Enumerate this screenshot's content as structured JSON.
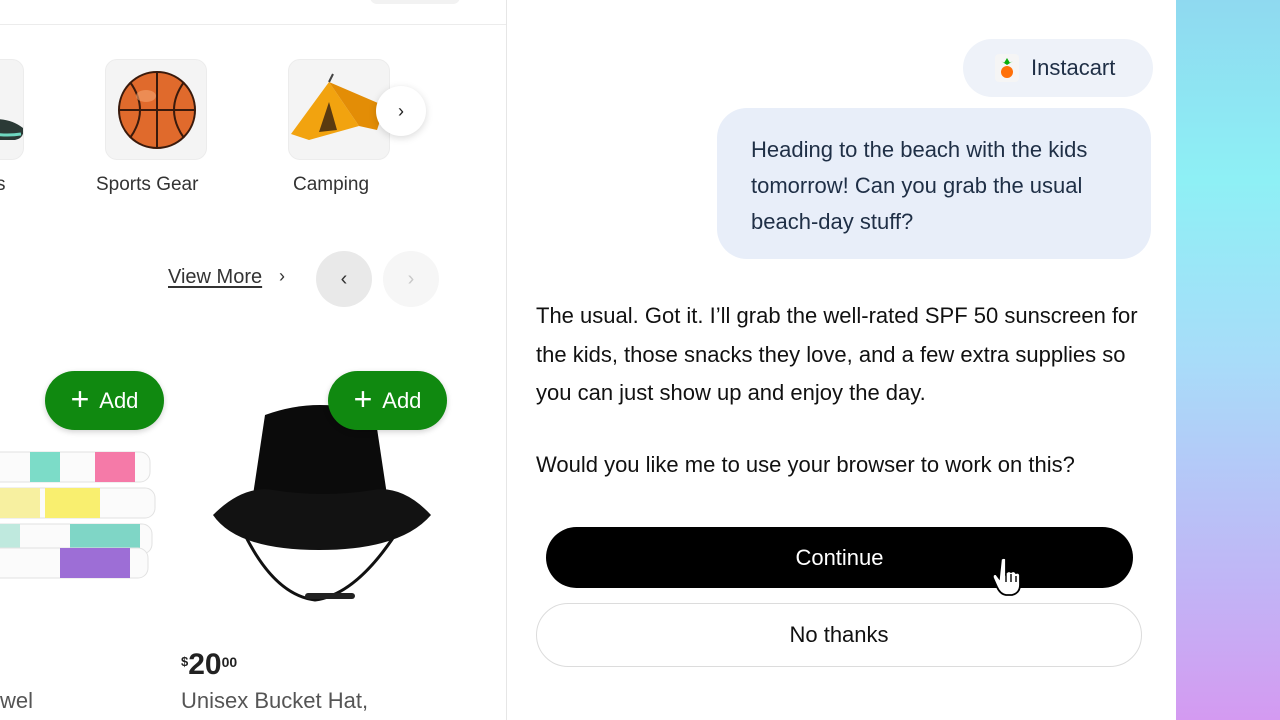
{
  "shop": {
    "categories": [
      {
        "label": "s",
        "icon": "sneaker-icon"
      },
      {
        "label": "Sports Gear",
        "icon": "basketball-icon"
      },
      {
        "label": "Camping",
        "icon": "tent-icon"
      }
    ],
    "categories_next_icon": "›",
    "view_more": "View More",
    "view_more_caret": "›",
    "pager_prev": "‹",
    "pager_next": "›",
    "add_label": "Add",
    "add_plus": "+",
    "products": [
      {
        "name": "wel"
      },
      {
        "name": "Unisex Bucket Hat,",
        "price_currency": "$",
        "price_whole": "20",
        "price_cents": "00"
      }
    ]
  },
  "chat": {
    "source_label": "Instacart",
    "user_message": "Heading to the beach with the kids tomorrow! Can you grab the usual beach-day stuff?",
    "assistant_message": "The usual. Got it. I’ll grab the well-rated SPF 50 sunscreen for the kids, those snacks they love, and a few extra supplies so you can just show up and enjoy the day.",
    "question": "Would you like me to use your browser to work on this?",
    "continue_label": "Continue",
    "no_thanks_label": "No thanks"
  },
  "colors": {
    "add_green": "#108910",
    "user_bubble": "#e8eef9",
    "continue_bg": "#000000"
  }
}
